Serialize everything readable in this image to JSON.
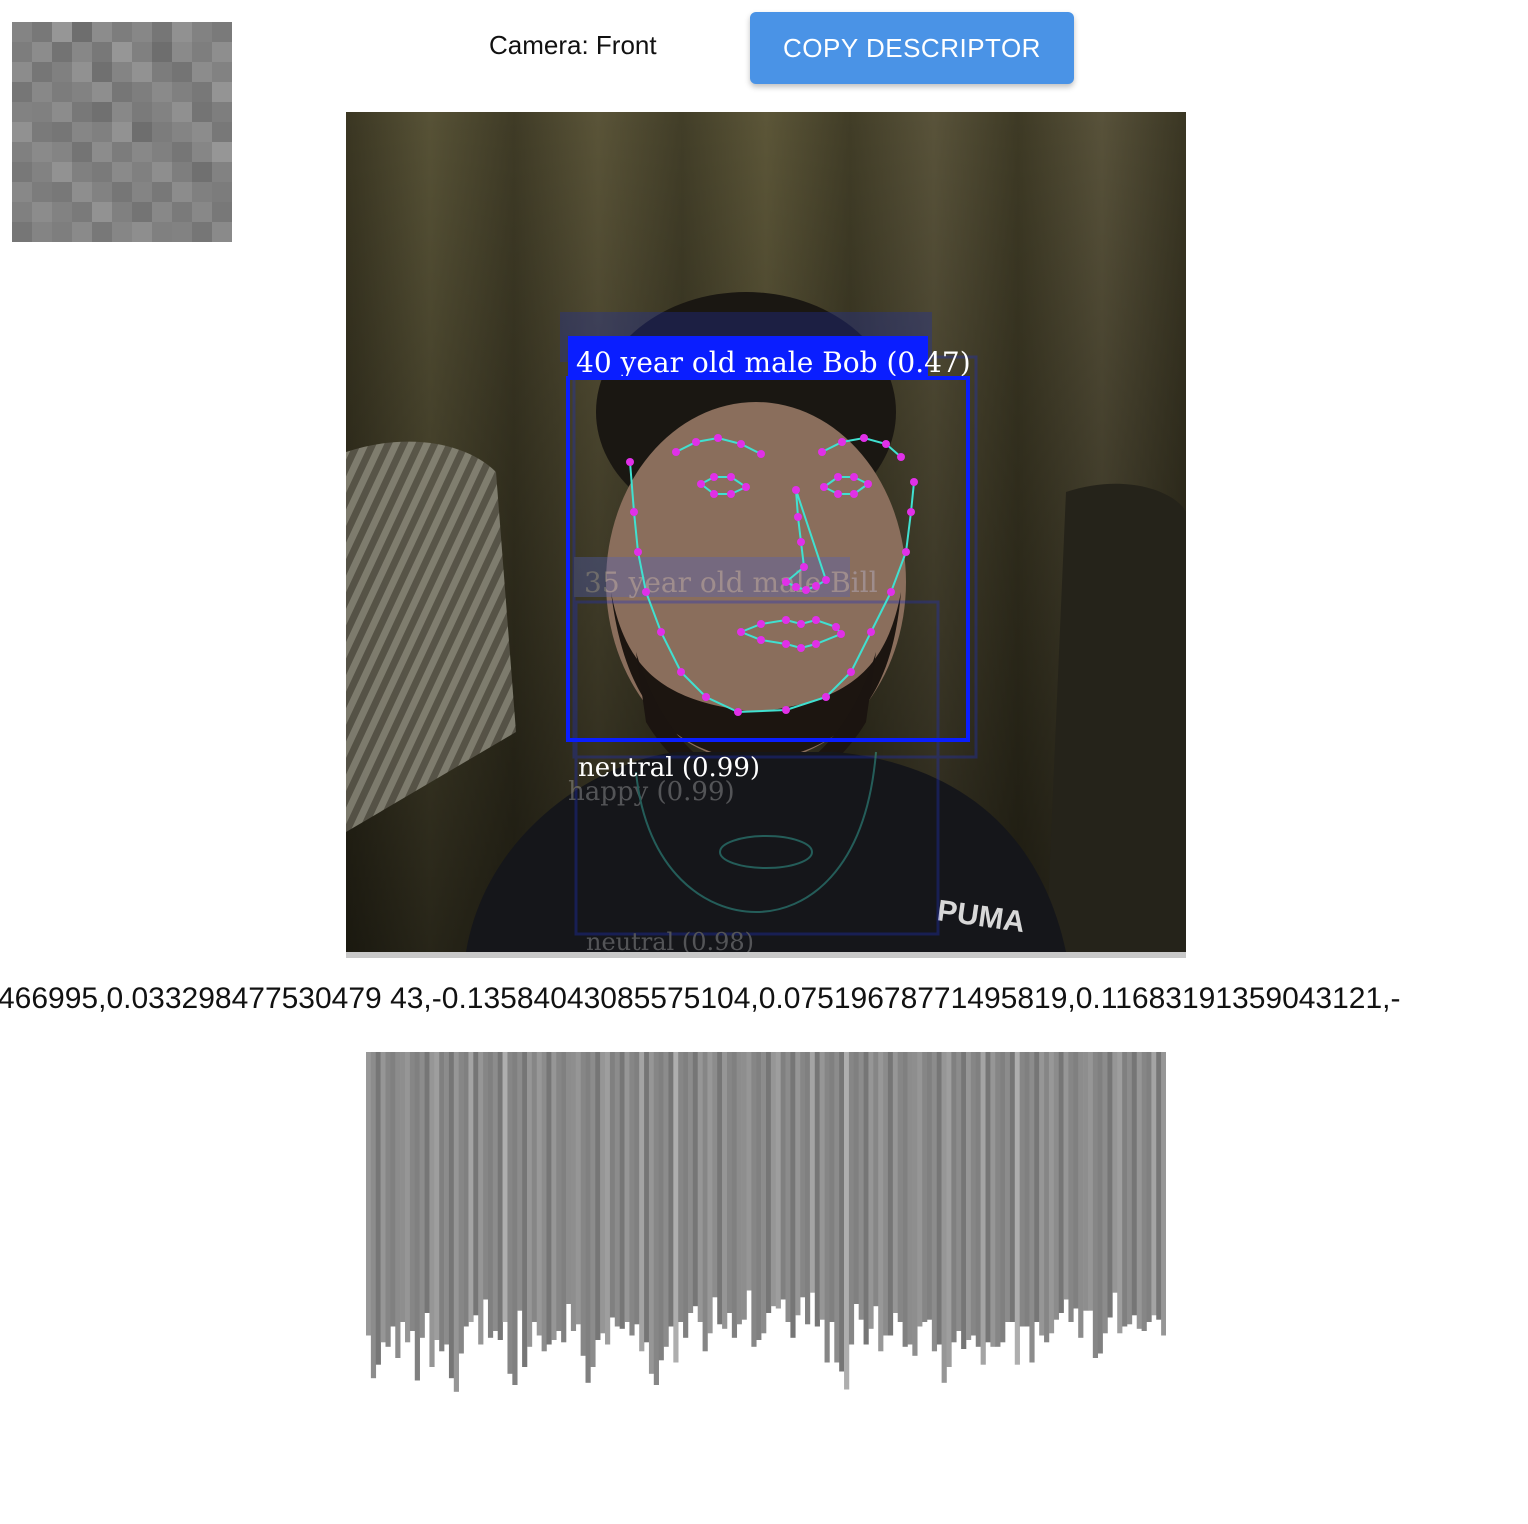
{
  "header": {
    "camera_label": "Camera: Front",
    "copy_button_label": "COPY DESCRIPTOR"
  },
  "thumbnail": {
    "pixel_grays": [
      [
        132,
        120,
        150,
        110,
        140,
        125,
        135,
        118,
        145,
        130,
        122
      ],
      [
        125,
        140,
        115,
        135,
        120,
        150,
        128,
        110,
        138,
        126,
        142
      ],
      [
        140,
        118,
        128,
        145,
        112,
        132,
        146,
        124,
        116,
        140,
        130
      ],
      [
        118,
        136,
        124,
        130,
        142,
        118,
        126,
        138,
        128,
        120,
        148
      ],
      [
        130,
        128,
        140,
        120,
        112,
        136,
        122,
        130,
        144,
        116,
        126
      ],
      [
        145,
        122,
        118,
        134,
        128,
        146,
        110,
        124,
        132,
        140,
        120
      ],
      [
        128,
        138,
        132,
        116,
        140,
        124,
        136,
        128,
        118,
        134,
        150
      ],
      [
        120,
        130,
        146,
        128,
        122,
        138,
        128,
        142,
        126,
        112,
        130
      ],
      [
        136,
        124,
        120,
        142,
        130,
        118,
        132,
        120,
        140,
        128,
        124
      ],
      [
        128,
        140,
        130,
        122,
        146,
        128,
        116,
        136,
        122,
        136,
        120
      ],
      [
        118,
        132,
        126,
        138,
        120,
        134,
        142,
        128,
        130,
        118,
        138
      ]
    ]
  },
  "video": {
    "detections": [
      {
        "label": "40 year old male Bob (0.47)",
        "expression": "neutral (0.99)",
        "style": "primary"
      },
      {
        "label": "35 year old male Bill",
        "expression": "happy (0.99)",
        "style": "ghost"
      },
      {
        "label": "neutral (0.98)",
        "style": "ghost"
      }
    ],
    "brand_text": "PUMA",
    "box_color": "#0a1eff",
    "landmark_color": "#e030e8",
    "mesh_color": "#40e0d0"
  },
  "descriptor_text": "466995,0.033298477530479 43,-0.13584043085575104,0.07519678771495819,0.11683191359043121,-",
  "chart_data": {
    "type": "bar",
    "title": "",
    "xlabel": "",
    "ylabel": "",
    "values": [
      1.26,
      1.45,
      1.39,
      1.29,
      1.31,
      1.22,
      1.36,
      1.2,
      1.29,
      1.24,
      1.46,
      1.27,
      1.16,
      1.4,
      1.28,
      1.33,
      1.3,
      1.45,
      1.51,
      1.34,
      1.22,
      1.2,
      1.17,
      1.3,
      1.1,
      1.27,
      1.24,
      1.28,
      1.2,
      1.43,
      1.48,
      1.15,
      1.4,
      1.31,
      1.2,
      1.26,
      1.33,
      1.3,
      1.28,
      1.24,
      1.29,
      1.12,
      1.24,
      1.21,
      1.35,
      1.47,
      1.4,
      1.28,
      1.25,
      1.3,
      1.18,
      1.22,
      1.23,
      1.2,
      1.26,
      1.21,
      1.33,
      1.29,
      1.43,
      1.48,
      1.37,
      1.31,
      1.22,
      1.38,
      1.2,
      1.27,
      1.16,
      1.13,
      1.2,
      1.33,
      1.25,
      1.09,
      1.21,
      1.23,
      1.16,
      1.27,
      1.21,
      1.19,
      1.06,
      1.31,
      1.28,
      1.25,
      1.16,
      1.13,
      1.14,
      1.1,
      1.2,
      1.27,
      1.17,
      1.09,
      1.21,
      1.07,
      1.22,
      1.19,
      1.38,
      1.2,
      1.38,
      1.42,
      1.5,
      1.3,
      1.12,
      1.19,
      1.3,
      1.23,
      1.13,
      1.33,
      1.26,
      1.26,
      1.16,
      1.2,
      1.31,
      1.3,
      1.35,
      1.22,
      1.2,
      1.19,
      1.33,
      1.3,
      1.47,
      1.4,
      1.29,
      1.24,
      1.32,
      1.28,
      1.26,
      1.31,
      1.39,
      1.29,
      1.31,
      1.31,
      1.29,
      1.2,
      1.2,
      1.39,
      1.22,
      1.22,
      1.38,
      1.2,
      1.26,
      1.29,
      1.25,
      1.19,
      1.16,
      1.1,
      1.2,
      1.14,
      1.27,
      1.15,
      1.15,
      1.36,
      1.34,
      1.25,
      1.18,
      1.07,
      1.25,
      1.22,
      1.21,
      1.17,
      1.23,
      1.24,
      1.2,
      1.17,
      1.19,
      1.26
    ],
    "ylim": [
      0,
      1.6
    ]
  }
}
